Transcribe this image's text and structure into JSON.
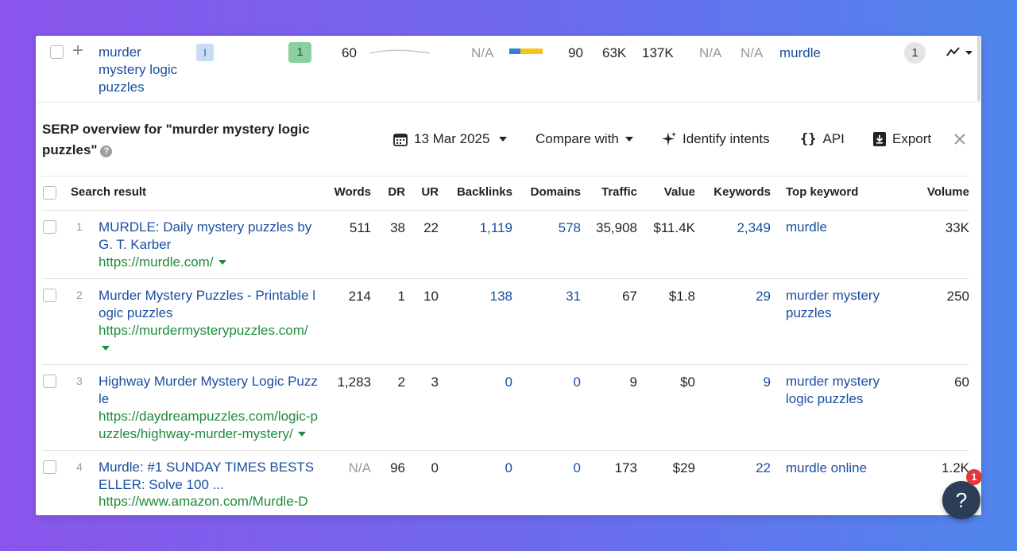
{
  "keyword_row": {
    "keyword": "murder mystery logic puzzles",
    "intent_badge": "I",
    "kd": "1",
    "sv": "60",
    "metric_na1": "N/A",
    "traffic_potential": "90",
    "metric_63k": "63K",
    "metric_137k": "137K",
    "metric_na2": "N/A",
    "metric_na3": "N/A",
    "parent_topic": "murdle",
    "serp_count": "1"
  },
  "serp": {
    "title": "SERP overview for \"murder mystery logic puzzles\"",
    "date": "13 Mar 2025",
    "compare_label": "Compare with",
    "intents_label": "Identify intents",
    "api_label": "API",
    "export_label": "Export"
  },
  "columns": {
    "result": "Search result",
    "words": "Words",
    "dr": "DR",
    "ur": "UR",
    "backlinks": "Backlinks",
    "domains": "Domains",
    "traffic": "Traffic",
    "value": "Value",
    "keywords": "Keywords",
    "top_keyword": "Top keyword",
    "volume": "Volume"
  },
  "rows": [
    {
      "pos": "1",
      "title": "MURDLE: Daily mystery puzzles by G. T. Karber",
      "url": "https://murdle.com/",
      "words": "511",
      "dr": "38",
      "ur": "22",
      "backlinks": "1,119",
      "domains": "578",
      "traffic": "35,908",
      "value": "$11.4K",
      "keywords": "2,349",
      "top_keyword": "murdle",
      "volume": "33K"
    },
    {
      "pos": "2",
      "title": "Murder Mystery Puzzles - Printable logic puzzles",
      "url": "https://murdermysterypuzzles.com/",
      "words": "214",
      "dr": "1",
      "ur": "10",
      "backlinks": "138",
      "domains": "31",
      "traffic": "67",
      "value": "$1.8",
      "keywords": "29",
      "top_keyword": "murder mystery puzzles",
      "volume": "250"
    },
    {
      "pos": "3",
      "title": "Highway Murder Mystery Logic Puzzle",
      "url": "https://daydreampuzzles.com/logic-puzzles/highway-murder-mystery/",
      "words": "1,283",
      "dr": "2",
      "ur": "3",
      "backlinks": "0",
      "domains": "0",
      "traffic": "9",
      "value": "$0",
      "keywords": "9",
      "top_keyword": "murder mystery logic puzzles",
      "volume": "60"
    },
    {
      "pos": "4",
      "title": "Murdle: #1 SUNDAY TIMES BESTSELLER: Solve 100 ...",
      "url": "https://www.amazon.com/Murdle-D",
      "words": "N/A",
      "dr": "96",
      "ur": "0",
      "backlinks": "0",
      "domains": "0",
      "traffic": "173",
      "value": "$29",
      "keywords": "22",
      "top_keyword": "murdle online",
      "volume": "1.2K"
    }
  ],
  "help": {
    "label": "?",
    "badge": "1"
  },
  "colors": {
    "accent_blue": "#1b4fa0",
    "url_green": "#1e8c3a",
    "kd_green": "#8ccf9e"
  }
}
